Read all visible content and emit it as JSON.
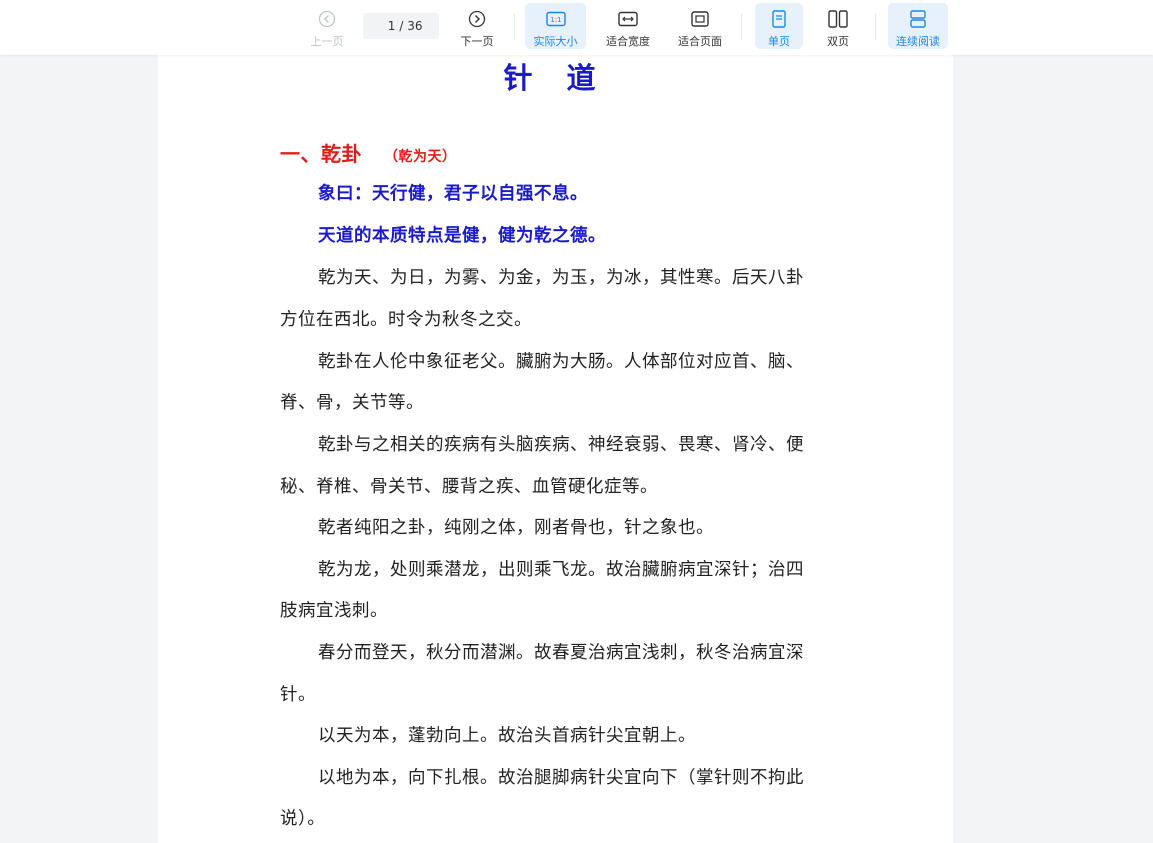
{
  "toolbar": {
    "prev_label": "上一页",
    "page_current": "1",
    "page_total": "/ 36",
    "next_label": "下一页",
    "actual_size_label": "实际大小",
    "fit_width_label": "适合宽度",
    "fit_page_label": "适合页面",
    "single_page_label": "单页",
    "double_page_label": "双页",
    "continuous_label": "连续阅读",
    "accent_color": "#1e88e5"
  },
  "document": {
    "title": "针 道",
    "heading": "一、乾卦",
    "heading_sub": "（乾为天）",
    "lines": [
      "象曰：天行健，君子以自强不息。",
      "天道的本质特点是健，健为乾之德。",
      "乾为天、为日，为雾、为金，为玉，为冰，其性寒。后天八卦",
      "方位在西北。时令为秋冬之交。",
      "乾卦在人伦中象征老父。臟腑为大肠。人体部位对应首、脑、",
      "脊、骨，关节等。",
      "乾卦与之相关的疾病有头脑疾病、神经衰弱、畏寒、肾冷、便",
      "秘、脊椎、骨关节、腰背之疾、血管硬化症等。",
      "乾者纯阳之卦，纯刚之体，刚者骨也，针之象也。",
      "乾为龙，处则乘潜龙，出则乘飞龙。故治臟腑病宜深针；治四",
      "肢病宜浅刺。",
      "春分而登天，秋分而潜渊。故春夏治病宜浅刺，秋冬治病宜深",
      "针。",
      "以天为本，蓬勃向上。故治头首病针尖宜朝上。",
      "以地为本，向下扎根。故治腿脚病针尖宜向下（掌针则不拘此",
      "说）。"
    ],
    "title_color": "#1a1acb",
    "heading_color": "#e31b1b"
  }
}
